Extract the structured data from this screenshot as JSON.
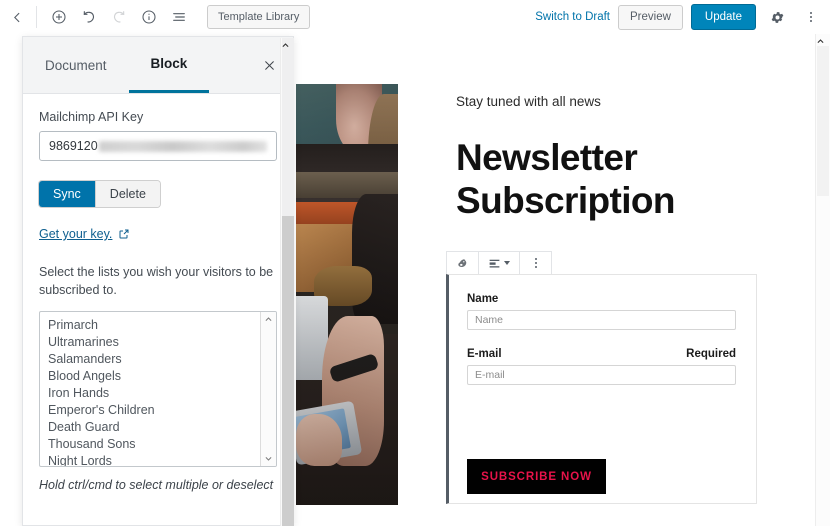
{
  "toolbar": {
    "back_icon": "chevron-left-icon",
    "add_block_icon": "plus-circle-icon",
    "undo_icon": "undo-arrow-icon",
    "redo_icon": "redo-arrow-icon",
    "info_icon": "info-circle-icon",
    "block_nav_icon": "list-view-icon",
    "template_library_label": "Template Library",
    "switch_to_draft_label": "Switch to Draft",
    "preview_label": "Preview",
    "update_label": "Update",
    "settings_icon": "gear-icon",
    "more_icon": "more-vertical-icon"
  },
  "sidebar": {
    "tabs": [
      {
        "label": "Document",
        "active": false
      },
      {
        "label": "Block",
        "active": true
      }
    ],
    "close_icon": "close-icon",
    "api_key_label": "Mailchimp API Key",
    "api_key_value": "9869120",
    "api_key_redacted": true,
    "sync_label": "Sync",
    "delete_label": "Delete",
    "get_key_label": "Get your key.",
    "external_link_icon": "external-link-icon",
    "lists_help": "Select the lists you wish your visitors to be subscribed to.",
    "lists": [
      "Primarch",
      "Ultramarines",
      "Salamanders",
      "Blood Angels",
      "Iron Hands",
      "Emperor's Children",
      "Death Guard",
      "Thousand Sons",
      "Night Lords"
    ],
    "list_scroll_up_icon": "chevron-up-icon",
    "list_scroll_down_icon": "chevron-down-icon",
    "note": "Hold ctrl/cmd to select multiple or deselect",
    "scroll_up_icon": "chevron-up-icon"
  },
  "canvas": {
    "eyebrow": "Stay tuned with all news",
    "heading_line1": "Newsletter",
    "heading_line2": "Subscription",
    "photo_alt": "person using a tablet on a dark wooden table",
    "scroll_up_icon": "chevron-up-icon"
  },
  "block_toolbar": {
    "block_type_icon": "mailchimp-freddie-icon",
    "align_icon": "align-block-icon",
    "align_caret_icon": "chevron-down-icon",
    "more_options_icon": "more-vertical-icon"
  },
  "form": {
    "name_label": "Name",
    "name_placeholder": "Name",
    "email_label": "E-mail",
    "email_required_label": "Required",
    "email_placeholder": "E-mail",
    "submit_label": "SUBSCRIBE NOW"
  },
  "colors": {
    "accent_blue": "#0085ba",
    "link_blue": "#0073aa",
    "tab_underline": "#00739c",
    "submit_bg": "#010101",
    "submit_text": "#e8134a"
  }
}
